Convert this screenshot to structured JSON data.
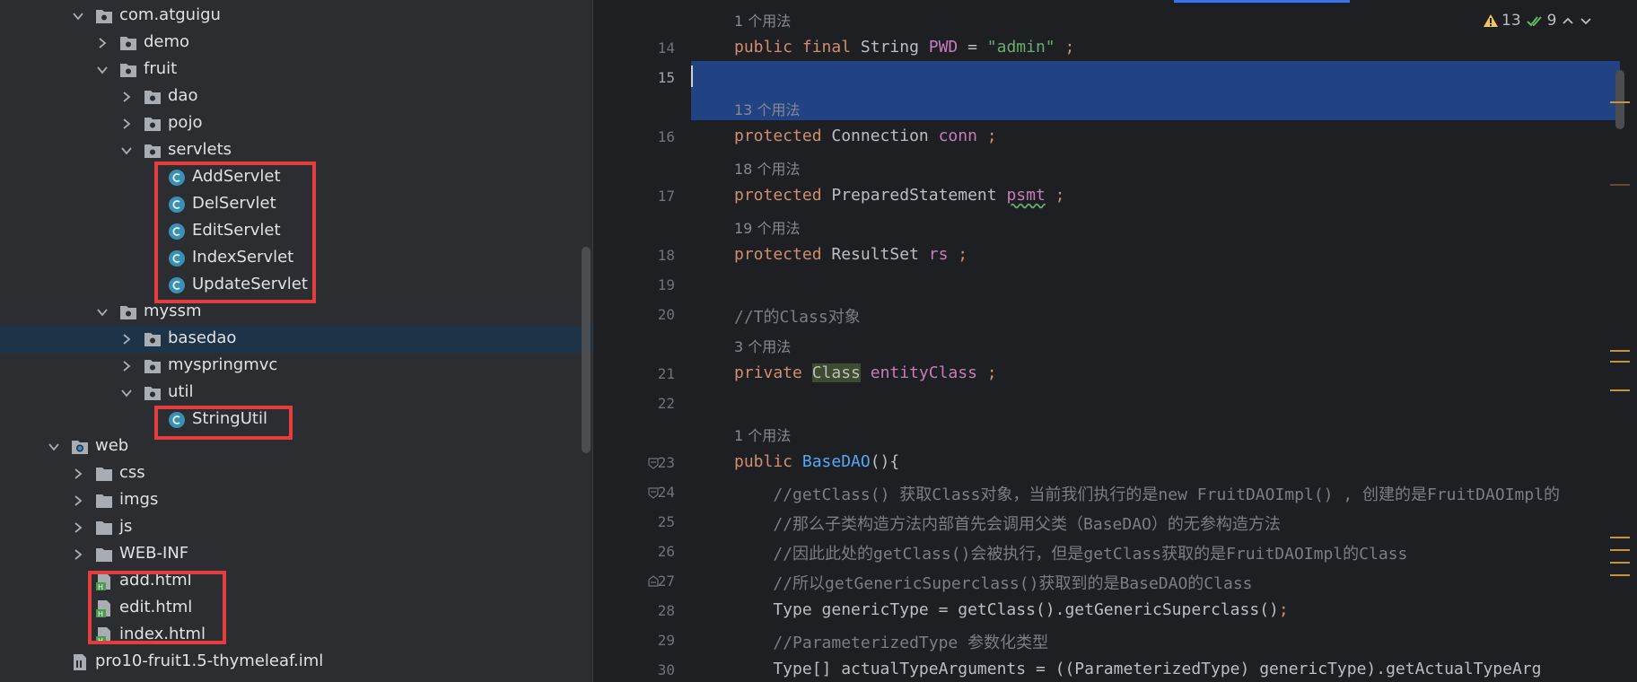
{
  "tree": {
    "items": [
      {
        "label": "com.atguigu",
        "depth": 1,
        "kind": "package",
        "expanded": true
      },
      {
        "label": "demo",
        "depth": 2,
        "kind": "package",
        "expanded": false
      },
      {
        "label": "fruit",
        "depth": 2,
        "kind": "package",
        "expanded": true
      },
      {
        "label": "dao",
        "depth": 3,
        "kind": "package",
        "expanded": false
      },
      {
        "label": "pojo",
        "depth": 3,
        "kind": "package",
        "expanded": false
      },
      {
        "label": "servlets",
        "depth": 3,
        "kind": "package",
        "expanded": true
      },
      {
        "label": "AddServlet",
        "depth": 4,
        "kind": "class"
      },
      {
        "label": "DelServlet",
        "depth": 4,
        "kind": "class"
      },
      {
        "label": "EditServlet",
        "depth": 4,
        "kind": "class"
      },
      {
        "label": "IndexServlet",
        "depth": 4,
        "kind": "class"
      },
      {
        "label": "UpdateServlet",
        "depth": 4,
        "kind": "class"
      },
      {
        "label": "myssm",
        "depth": 2,
        "kind": "package",
        "expanded": true
      },
      {
        "label": "basedao",
        "depth": 3,
        "kind": "package",
        "expanded": false,
        "selected": true
      },
      {
        "label": "myspringmvc",
        "depth": 3,
        "kind": "package",
        "expanded": false
      },
      {
        "label": "util",
        "depth": 3,
        "kind": "package",
        "expanded": true
      },
      {
        "label": "StringUtil",
        "depth": 4,
        "kind": "class"
      },
      {
        "label": "web",
        "depth": 0,
        "kind": "webfolder",
        "expanded": true
      },
      {
        "label": "css",
        "depth": 1,
        "kind": "folder",
        "expanded": false
      },
      {
        "label": "imgs",
        "depth": 1,
        "kind": "folder",
        "expanded": false
      },
      {
        "label": "js",
        "depth": 1,
        "kind": "folder",
        "expanded": false
      },
      {
        "label": "WEB-INF",
        "depth": 1,
        "kind": "folder",
        "expanded": false
      },
      {
        "label": "add.html",
        "depth": 1,
        "kind": "html"
      },
      {
        "label": "edit.html",
        "depth": 1,
        "kind": "html"
      },
      {
        "label": "index.html",
        "depth": 1,
        "kind": "html"
      },
      {
        "label": "pro10-fruit1.5-thymeleaf.iml",
        "depth": 0,
        "kind": "iml"
      }
    ]
  },
  "editor": {
    "inspections": {
      "warnings": "13",
      "weak_warnings": "9"
    },
    "lines": [
      {
        "num": "",
        "hint": "1 个用法"
      },
      {
        "num": "14",
        "tokens": [
          [
            "kw",
            "public final "
          ],
          [
            "",
            "String "
          ],
          [
            "fld",
            "PWD"
          ],
          [
            "",
            " = "
          ],
          [
            "str",
            "\"admin\""
          ],
          [
            "kw",
            " ;"
          ]
        ]
      },
      {
        "num": "15",
        "current": true,
        "tokens": []
      },
      {
        "num": "",
        "hint": "13 个用法"
      },
      {
        "num": "16",
        "tokens": [
          [
            "kw",
            "protected "
          ],
          [
            "",
            "Connection "
          ],
          [
            "fld",
            "conn"
          ],
          [
            "kw",
            " ;"
          ]
        ]
      },
      {
        "num": "",
        "hint": "18 个用法"
      },
      {
        "num": "17",
        "tokens": [
          [
            "kw",
            "protected "
          ],
          [
            "",
            "PreparedStatement "
          ],
          [
            "fld wavy",
            "psmt"
          ],
          [
            "kw",
            " ;"
          ]
        ]
      },
      {
        "num": "",
        "hint": "19 个用法"
      },
      {
        "num": "18",
        "tokens": [
          [
            "kw",
            "protected "
          ],
          [
            "",
            "ResultSet "
          ],
          [
            "fld",
            "rs"
          ],
          [
            "kw",
            " ;"
          ]
        ]
      },
      {
        "num": "19",
        "tokens": []
      },
      {
        "num": "20",
        "tokens": [
          [
            "cmt",
            "//T的Class对象"
          ]
        ]
      },
      {
        "num": "",
        "hint": "3 个用法"
      },
      {
        "num": "21",
        "tokens": [
          [
            "kw",
            "private "
          ],
          [
            "cls-hl",
            "Class"
          ],
          [
            "",
            " "
          ],
          [
            "fld",
            "entityClass"
          ],
          [
            "kw",
            " ;"
          ]
        ]
      },
      {
        "num": "22",
        "tokens": []
      },
      {
        "num": "",
        "hint": "1 个用法"
      },
      {
        "num": "23",
        "fold": "open",
        "tokens": [
          [
            "kw",
            "public "
          ],
          [
            "fn",
            "BaseDAO"
          ],
          [
            "",
            "(){"
          ]
        ]
      },
      {
        "num": "24",
        "fold": "open",
        "tokens": [
          [
            "",
            "    "
          ],
          [
            "cmt",
            "//getClass() 获取Class对象，当前我们执行的是new FruitDAOImpl() , 创建的是FruitDAOImpl的"
          ]
        ]
      },
      {
        "num": "25",
        "tokens": [
          [
            "",
            "    "
          ],
          [
            "cmt",
            "//那么子类构造方法内部首先会调用父类（BaseDAO）的无参构造方法"
          ]
        ]
      },
      {
        "num": "26",
        "tokens": [
          [
            "",
            "    "
          ],
          [
            "cmt",
            "//因此此处的getClass()会被执行，但是getClass获取的是FruitDAOImpl的Class"
          ]
        ]
      },
      {
        "num": "27",
        "fold": "close",
        "tokens": [
          [
            "",
            "    "
          ],
          [
            "cmt",
            "//所以getGenericSuperclass()获取到的是BaseDAO的Class"
          ]
        ]
      },
      {
        "num": "28",
        "tokens": [
          [
            "",
            "    Type genericType = getClass().getGenericSuperclass()"
          ],
          [
            "kw",
            ";"
          ]
        ]
      },
      {
        "num": "29",
        "tokens": [
          [
            "",
            "    "
          ],
          [
            "cmt",
            "//ParameterizedType 参数化类型"
          ]
        ]
      },
      {
        "num": "30",
        "tokens": [
          [
            "",
            "    Type[] actualTypeArguments = ((ParameterizedType) genericType).getActualTypeArg"
          ]
        ]
      }
    ]
  },
  "colors": {
    "highlight_box": "#e43d3d",
    "selection": "#214283",
    "tree_selection": "#1d3348",
    "keyword": "#cf8e6d",
    "field": "#c77dbb",
    "string": "#6aab73",
    "comment": "#7a7e85",
    "method": "#56a8f5"
  }
}
